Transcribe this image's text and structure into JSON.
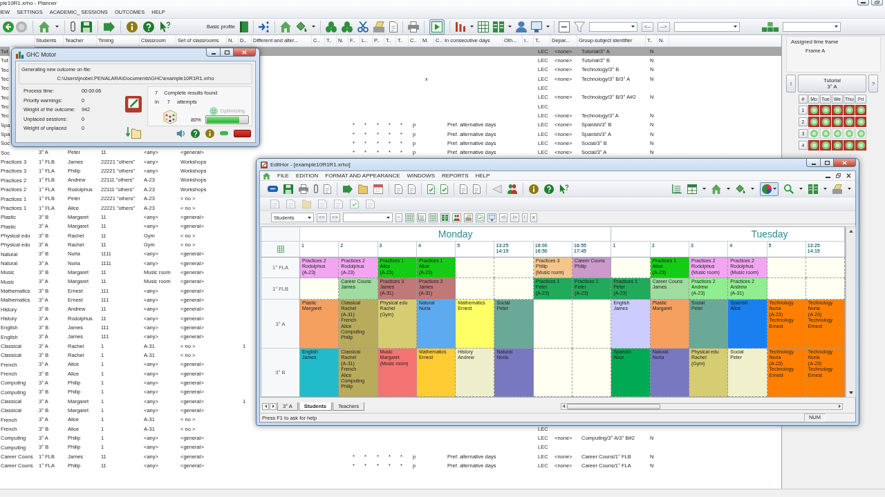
{
  "window": {
    "title": "ple10R1.xrho - Planner"
  },
  "menu": [
    "IEW",
    "SETTINGS",
    "ACADEMIC_ SESSIONS",
    "OUTCOMES",
    "HELP"
  ],
  "toolbar": {
    "profile": "Basic profile",
    "play_toggle": {
      "pressed": true
    },
    "back_button": "<--",
    "forward_button": "-->"
  },
  "table": {
    "columns": [
      "Students",
      "Teacher",
      "Timing",
      "Classroom",
      "Set of classrooms",
      "N.",
      "D..",
      "Different and alter...",
      "C..",
      "T..",
      "N.",
      "F..",
      "L..",
      "P..",
      "T..",
      "T..",
      "C..",
      "M.",
      "C..",
      "In consecutive days",
      "Oth...",
      "I..",
      "T..",
      "Depar...",
      "Group-subject identifier",
      "T..",
      "N."
    ],
    "rows": [
      {
        "selected": true,
        "column_1": "Tut",
        "column_24": "LEC",
        "column_25": "<none>",
        "group_subject_identifier": "Tutorial/3° A",
        "column_27": "N"
      },
      {
        "selected": false,
        "column_1": "Tut",
        "column_24": "LEC",
        "column_25": "<none>",
        "group_subject_identifier": "Tutorial/3° B",
        "column_27": "N"
      },
      {
        "selected": false,
        "column_1": "Tec",
        "column_24": "LEC",
        "column_25": "<none>",
        "group_subject_identifier": "Technology/3° B",
        "column_27": "N"
      },
      {
        "selected": false,
        "column_1": "Tec",
        "column_19": "x",
        "column_24": "LEC",
        "column_25": "<none>",
        "group_subject_identifier": "Technology/3° B/3° A",
        "column_27": "N"
      },
      {
        "selected": false,
        "column_1": "Tec",
        "column_24": "LEC"
      },
      {
        "selected": false,
        "column_1": "Tec",
        "column_24": "LEC",
        "column_25": "<none>",
        "group_subject_identifier": "Technology/3° B/3° A#2",
        "column_27": "N"
      },
      {
        "selected": false,
        "column_1": "Tec",
        "column_24": "LEC"
      },
      {
        "selected": false,
        "column_1": "Tec",
        "column_24": "LEC",
        "column_25": "<none>",
        "group_subject_identifier": "Technology/3° A",
        "column_27": "N"
      },
      {
        "selected": false,
        "column_1": "Spa",
        "column_13": "*",
        "column_14": "*",
        "column_15": "*",
        "column_16": "*",
        "column_17": "*",
        "column_18": "p",
        "in_consecutive_days": "Pref. alternative days",
        "column_24": "LEC",
        "column_25": "<none>",
        "group_subject_identifier": "Spanish/3° B",
        "column_27": "N"
      },
      {
        "selected": false,
        "column_1": "Spa",
        "column_13": "*",
        "column_14": "*",
        "column_15": "*",
        "column_16": "*",
        "column_17": "*",
        "column_18": "p",
        "in_consecutive_days": "Pref. alternative days",
        "column_24": "LEC",
        "column_25": "<none>",
        "group_subject_identifier": "Spanish/3° A",
        "column_27": "N"
      },
      {
        "selected": false,
        "column_1": "Soc",
        "column_13": "*",
        "column_14": "*",
        "column_15": "*",
        "column_16": "*",
        "column_17": "*",
        "column_18": "p",
        "in_consecutive_days": "Pref. alternative days",
        "column_24": "LEC",
        "column_25": "<none>",
        "group_subject_identifier": "Social/3° B",
        "column_27": "N"
      },
      {
        "selected": false,
        "column_1": "Soc",
        "students": "3° A",
        "teacher": "Peter",
        "timing": "11",
        "classroom": "<any>",
        "set_of_classrooms": "<general>",
        "column_13": "*",
        "column_14": "*",
        "column_15": "*",
        "column_16": "*",
        "column_17": "*",
        "column_18": "p",
        "in_consecutive_days": "Pref. alternative days",
        "column_24": "LEC",
        "column_25": "<none>",
        "group_subject_identifier": "Social/3° A",
        "column_27": "N"
      },
      {
        "selected": false,
        "column_1": "Practices 3",
        "students": "1° FLB",
        "teacher": "James",
        "timing": "22221 \"others\"",
        "classroom": "<any>",
        "set_of_classrooms": "Workshops"
      },
      {
        "selected": false,
        "column_1": "Practices 3",
        "students": "1° FLA",
        "teacher": "Philip",
        "timing": "22221 \"others\"",
        "classroom": "<any>",
        "set_of_classrooms": "Workshops"
      },
      {
        "selected": false,
        "column_1": "Practices 2",
        "students": "1° FLB",
        "teacher": "Andrew",
        "timing": "22111 \"others\"",
        "classroom": "A-23",
        "set_of_classrooms": "Workshops"
      },
      {
        "selected": false,
        "column_1": "Practices 2",
        "students": "1° FLA",
        "teacher": "Rodolphus",
        "timing": "22111 \"others\"",
        "classroom": "A-23",
        "set_of_classrooms": "Workshops"
      },
      {
        "selected": false,
        "column_1": "Practices 1",
        "students": "1° FLB",
        "teacher": "Peter",
        "timing": "22221 \"others\"",
        "classroom": "A-23",
        "set_of_classrooms": "< no >"
      },
      {
        "selected": false,
        "column_1": "Practices 1",
        "students": "1° FLA",
        "teacher": "Alice",
        "timing": "22221 \"others\"",
        "classroom": "A-23",
        "set_of_classrooms": "< no >"
      },
      {
        "selected": false,
        "column_1": "Plastic",
        "students": "3° B",
        "teacher": "Margaret",
        "timing": "11",
        "classroom": "<any>",
        "set_of_classrooms": "<general>"
      },
      {
        "selected": false,
        "column_1": "Plastic",
        "students": "3° A",
        "teacher": "Margaret",
        "timing": "11",
        "classroom": "<any>",
        "set_of_classrooms": "<general>"
      },
      {
        "selected": false,
        "column_1": "Physical edu",
        "students": "3° B",
        "teacher": "Rachel",
        "timing": "11",
        "classroom": "Gym",
        "set_of_classrooms": "< no >"
      },
      {
        "selected": false,
        "column_1": "Physical edu",
        "students": "3° A",
        "teacher": "Rachel",
        "timing": "11",
        "classroom": "Gym",
        "set_of_classrooms": "< no >"
      },
      {
        "selected": false,
        "column_1": "Natural",
        "students": "3° B",
        "teacher": "Nuria",
        "timing": "1111",
        "classroom": "<any>",
        "set_of_classrooms": "<general>"
      },
      {
        "selected": false,
        "column_1": "Natural",
        "students": "3° A",
        "teacher": "Nuria",
        "timing": "1111",
        "classroom": "<any>",
        "set_of_classrooms": "<general>"
      },
      {
        "selected": false,
        "column_1": "Music",
        "students": "3° B",
        "teacher": "Margaret",
        "timing": "11",
        "classroom": "Music room",
        "set_of_classrooms": "<general>"
      },
      {
        "selected": false,
        "column_1": "Music",
        "students": "3° A",
        "teacher": "Margaret",
        "timing": "11",
        "classroom": "Music room",
        "set_of_classrooms": "<general>"
      },
      {
        "selected": false,
        "column_1": "Mathematics",
        "students": "3° B",
        "teacher": "Ernest",
        "timing": "111",
        "classroom": "<any>",
        "set_of_classrooms": "<general>"
      },
      {
        "selected": false,
        "column_1": "Mathematics",
        "students": "3° A",
        "teacher": "Ernest",
        "timing": "111",
        "classroom": "<any>",
        "set_of_classrooms": "<general>"
      },
      {
        "selected": false,
        "column_1": "History",
        "students": "3° B",
        "teacher": "Andrew",
        "timing": "11",
        "classroom": "<any>",
        "set_of_classrooms": "<general>"
      },
      {
        "selected": false,
        "column_1": "History",
        "students": "3° A",
        "teacher": "Rodolphus",
        "timing": "11",
        "classroom": "<any>",
        "set_of_classrooms": "<general>"
      },
      {
        "selected": false,
        "column_1": "English",
        "students": "3° B",
        "teacher": "James",
        "timing": "111",
        "classroom": "<any>",
        "set_of_classrooms": "<general>"
      },
      {
        "selected": false,
        "column_1": "English",
        "students": "3° A",
        "teacher": "James",
        "timing": "111",
        "classroom": "<any>",
        "set_of_classrooms": "<general>"
      },
      {
        "selected": false,
        "column_1": "Classical",
        "students": "3° A",
        "teacher": "Rachel",
        "timing": "1",
        "classroom": "A-31",
        "set_of_classrooms": "< no >",
        "column_8": "1"
      },
      {
        "selected": false,
        "column_1": "Classical",
        "students": "3° B",
        "teacher": "Rachel",
        "timing": "1",
        "classroom": "A-31",
        "set_of_classrooms": "< no >"
      },
      {
        "selected": false,
        "column_1": "French",
        "students": "3° A",
        "teacher": "Alice",
        "timing": "1",
        "classroom": "<any>",
        "set_of_classrooms": "<general>"
      },
      {
        "selected": false,
        "column_1": "French",
        "students": "3° B",
        "teacher": "Alice",
        "timing": "1",
        "classroom": "<any>",
        "set_of_classrooms": "<general>"
      },
      {
        "selected": false,
        "column_1": "Computing",
        "students": "3° A",
        "teacher": "Philip",
        "timing": "1",
        "classroom": "<any>",
        "set_of_classrooms": "<general>"
      },
      {
        "selected": false,
        "column_1": "Computing",
        "students": "3° B",
        "teacher": "Philip",
        "timing": "1",
        "classroom": "<any>",
        "set_of_classrooms": "<general>"
      },
      {
        "selected": false,
        "column_1": "Classical",
        "students": "3° A",
        "teacher": "Margaret",
        "timing": "1",
        "classroom": "<any>",
        "set_of_classrooms": "<general>",
        "column_8": "1"
      },
      {
        "selected": false,
        "column_1": "Classical",
        "students": "3° B",
        "teacher": "Margaret",
        "timing": "1",
        "classroom": "<any>",
        "set_of_classrooms": "<general>"
      },
      {
        "selected": false,
        "column_1": "French",
        "students": "3° A",
        "teacher": "Alice",
        "timing": "1",
        "classroom": "A-31",
        "set_of_classrooms": "< no >"
      },
      {
        "selected": false,
        "column_1": "French",
        "students": "3° B",
        "teacher": "Alice",
        "timing": "1",
        "classroom": "A-31",
        "set_of_classrooms": "< no >",
        "column_24": "LEC"
      },
      {
        "selected": false,
        "column_1": "Computing",
        "students": "3° A",
        "teacher": "Philip",
        "timing": "1",
        "classroom": "<any>",
        "set_of_classrooms": "<general>",
        "column_24": "LEC",
        "column_25": "<none>",
        "group_subject_identifier": "Computing/3° A/3° B#2",
        "column_27": "N"
      },
      {
        "selected": false,
        "column_1": "Computing",
        "students": "3° B",
        "teacher": "Philip",
        "timing": "1",
        "classroom": "<any>",
        "set_of_classrooms": "<general>",
        "column_24": "LEC"
      },
      {
        "selected": false,
        "column_1": "Career Couns",
        "students": "1° FLB",
        "teacher": "James",
        "timing": "11",
        "classroom": "<any>",
        "set_of_classrooms": "<general>",
        "column_13": "*",
        "column_14": "*",
        "column_15": "*",
        "column_16": "*",
        "column_17": "*",
        "column_18": "p",
        "in_consecutive_days": "Pref. alternative days",
        "column_24": "LEC",
        "column_25": "<none>",
        "group_subject_identifier": "Career Couns/1° FLB",
        "column_27": "N"
      },
      {
        "selected": false,
        "column_1": "Career Couns",
        "students": "1° FLA",
        "teacher": "Philip",
        "timing": "11",
        "classroom": "<any>",
        "set_of_classrooms": "<general>",
        "column_13": "*",
        "column_14": "*",
        "column_15": "*",
        "column_16": "*",
        "column_17": "*",
        "column_18": "p",
        "in_consecutive_days": "Pref. alternative days",
        "column_24": "LEC",
        "column_25": "<none>",
        "group_subject_identifier": "Career Couns/1° FLA",
        "column_27": "N"
      }
    ]
  },
  "side_panel": {
    "frame_title": "Assigned time frame",
    "frame": "Frame A",
    "left_button": "!",
    "session_button": "Tutorial\n3° A",
    "right_button": "?",
    "grid": {
      "corner": "#",
      "days": [
        "Mo",
        "Tue",
        "We",
        "Thu",
        "Fri"
      ],
      "rows": [
        {
          "period": "1",
          "slots": [
            {
              "blocked": true
            },
            {
              "blocked": true
            },
            {
              "blocked": true
            },
            {
              "blocked": true
            },
            {
              "blocked": true
            }
          ]
        },
        {
          "period": "2",
          "slots": [
            {
              "blocked": true
            },
            {
              "blocked": true
            },
            {
              "blocked": true
            },
            {
              "blocked": true
            },
            {
              "blocked": true
            }
          ]
        },
        {
          "period": "3",
          "slots": [
            {
              "blocked": false
            },
            {
              "blocked": false
            },
            {
              "blocked": false
            },
            {
              "blocked": false
            },
            {
              "blocked": false
            }
          ]
        },
        {
          "period": "4",
          "slots": [
            {
              "blocked": true
            },
            {
              "blocked": true
            },
            {
              "blocked": true
            },
            {
              "blocked": true
            },
            {
              "blocked": true
            }
          ]
        }
      ]
    }
  },
  "motor_dialog": {
    "title": "GHC Motor",
    "file_label": "Generating new outcome on file:",
    "file_path": "C:\\Users\\jnobel.PENALARA\\Documents\\GHC\\example10R1R1.xrho",
    "stats": [
      {
        "label": "Process time:",
        "value": "00:00:06"
      },
      {
        "label": "Priority warnings:",
        "value": "0"
      },
      {
        "label": "Weight of the outcome:",
        "value": "942"
      },
      {
        "label": "Unplaced sessions:",
        "value": "0"
      },
      {
        "label": "Weight of unplaced",
        "value": "0"
      }
    ],
    "results": {
      "found": "7",
      "found_label": "Complete results found",
      "in_label": "in",
      "attempts": "7",
      "attempts_label": "attempts",
      "status": {
        "text": "Optimizing",
        "disabled": true
      },
      "percent": "80%",
      "level": 0.8
    }
  },
  "edithor": {
    "title": "EditHor - [example10R1R1.xrho]",
    "menu": [
      "FILE",
      "EDITION",
      "FORMAT AND APPEARANCE",
      "WINDOWS",
      "REPORTS",
      "HELP"
    ],
    "pie_toggle": {
      "pressed": true
    },
    "filter_bar": {
      "view": "Students",
      "left_buttons": [
        "<=",
        "=>"
      ],
      "tilde_button": "~",
      "right_buttons": [
        "<\\",
        "/>",
        "!",
        "x"
      ]
    },
    "timetable": {
      "days": [
        {
          "name": "Monday",
          "periods": [
            "1",
            "2",
            "3",
            "4",
            "5",
            "13:25\n14:15",
            "16:00\n16:50",
            "16:55\n17:45"
          ]
        },
        {
          "name": "Tuesday",
          "periods": [
            "1",
            "2",
            "3",
            "4",
            "5",
            "13:25\n14:15"
          ]
        }
      ],
      "rows": [
        {
          "group": "1° FLA",
          "cells": [
            {
              "text": "Practices 2\nRodolphus\n(A-23)",
              "color": "#f2a6f2"
            },
            {
              "text": "Practices 2\nRodolphus\n(A-23)",
              "color": "#f2a6f2"
            },
            {
              "text": "Practices 1\nAlice\n(A-23)",
              "color": "#14cc14"
            },
            {
              "text": "Practices 1\nAlice\n(A-23)",
              "color": "#14cc14"
            },
            null,
            null,
            {
              "text": "Practices 3\nPhilip\n(Music room)",
              "color": "#f5c58c"
            },
            {
              "text": "Career Couns\nPhilip",
              "color": "#cc99cc"
            },
            null,
            {
              "text": "Practices 1\nAlice\n(A-23)",
              "color": "#14cc14"
            },
            {
              "text": "Practices 2\nRodolphus\n(Music room)",
              "color": "#f2a6f2"
            },
            {
              "text": "Practices 2\nRodolphus\n(Music room)",
              "color": "#f2a6f2"
            },
            null,
            null
          ]
        },
        {
          "group": "1° FLB",
          "cells": [
            null,
            {
              "text": "Career Couns\nJames",
              "color": "#a0dca0"
            },
            {
              "text": "Practices 3\nJames\n(A-31)",
              "color": "#c07878"
            },
            {
              "text": "Practices 3\nJames\n(A-31)",
              "color": "#c07878"
            },
            null,
            null,
            {
              "text": "Practices 1\nPeter\n(A-23)",
              "color": "#20aa5a"
            },
            {
              "text": "Practices 1\nPeter\n(A-23)",
              "color": "#20aa5a"
            },
            {
              "text": "Practices 1\nPeter\n(A-23)",
              "color": "#20aa5a"
            },
            {
              "text": "Career Couns\nJames",
              "color": "#a0dca0"
            },
            {
              "text": "Practices 2\nAndrew\n(A-23)",
              "color": "#90ee90"
            },
            {
              "text": "Practices 2\nAndrew\n(A-31)",
              "color": "#90ee90"
            },
            null,
            null
          ]
        },
        {
          "group": "3° A",
          "cells": [
            {
              "text": "Plastic\nMargaret",
              "color": "#f6a060"
            },
            {
              "text": "Classical\nRachel\n(A-31)\nFrench\nAlice\nComputing\nPhilip",
              "color": "#b8ac5c"
            },
            {
              "text": "Physical edu\nRachel\n(Gym)",
              "color": "#d6cc72"
            },
            {
              "text": "Natural\nNuria",
              "color": "#5eaaf0"
            },
            {
              "text": "Mathematics\nErnest",
              "color": "#ffff66"
            },
            {
              "text": "Social\nPeter",
              "color": "#6aa898"
            },
            null,
            null,
            {
              "text": "English\nJames",
              "color": "#ccccff"
            },
            {
              "text": "Plastic\nMargaret",
              "color": "#f6a060"
            },
            {
              "text": "Social\nPeter",
              "color": "#6aa898"
            },
            {
              "text": "Spanish\nAlice",
              "color": "#1a80f0"
            },
            {
              "text": "Technology\nNuria\n(A-23)\nTechnology\nErnest",
              "color": "#ff8000"
            },
            {
              "text": "Technology\nNuria\n(A-23)\nTechnology\nErnest",
              "color": "#ff8000"
            }
          ]
        },
        {
          "group": "3° B",
          "cells": [
            {
              "text": "English\nJames",
              "color": "#22bbcc"
            },
            {
              "text": "Classical\nRachel\n(A-31)\nFrench\nAlice\nComputing\nPhilip",
              "color": "#b8ac5c"
            },
            {
              "text": "Music\nMargaret\n(Music room)",
              "color": "#f47474"
            },
            {
              "text": "Mathematics\nErnest",
              "color": "#ffcc33"
            },
            {
              "text": "History\nAndrew",
              "color": "#eeeecc"
            },
            {
              "text": "Natural\nNuria",
              "color": "#7878c0"
            },
            null,
            null,
            {
              "text": "Spanish\nAlice",
              "color": "#00aa55"
            },
            {
              "text": "Natural\nNuria",
              "color": "#7878c0"
            },
            {
              "text": "Physical edu\nRachel\n(Gym)",
              "color": "#d6cc72"
            },
            {
              "text": "Social\nPeter",
              "color": "#f0f0cc"
            },
            {
              "text": "Technology\nNuria\n(A-23)\nTechnology\nErnest",
              "color": "#ff8000"
            },
            {
              "text": "Technology\nNuria\n(A-23)\nTechnology\nErnest",
              "color": "#ff8000"
            }
          ]
        }
      ]
    },
    "tabs": [
      {
        "label": "3° A",
        "selected": false
      },
      {
        "label": "Students",
        "selected": true
      },
      {
        "label": "Teachers",
        "selected": false
      }
    ],
    "status": "Press F1 to ask for help",
    "indicator": "NUM"
  }
}
